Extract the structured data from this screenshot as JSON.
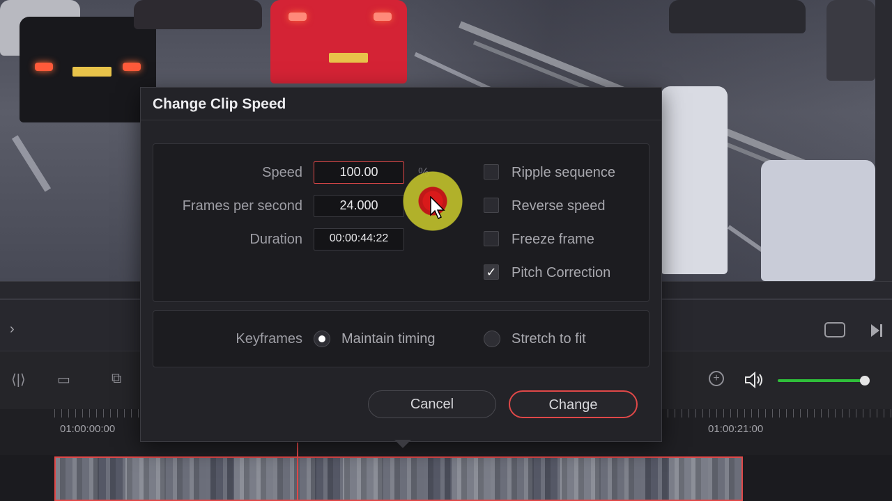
{
  "dialog": {
    "title": "Change Clip Speed",
    "speed_label": "Speed",
    "speed_value": "100.00",
    "speed_unit": "%",
    "fps_label": "Frames per second",
    "fps_value": "24.000",
    "duration_label": "Duration",
    "duration_value": "00:00:44:22",
    "options": [
      {
        "label": "Ripple sequence",
        "checked": false
      },
      {
        "label": "Reverse speed",
        "checked": false
      },
      {
        "label": "Freeze frame",
        "checked": false
      },
      {
        "label": "Pitch Correction",
        "checked": true
      }
    ],
    "keyframes_label": "Keyframes",
    "keyframe_options": [
      {
        "label": "Maintain timing",
        "selected": true
      },
      {
        "label": "Stretch to fit",
        "selected": false
      }
    ],
    "cancel_label": "Cancel",
    "change_label": "Change"
  },
  "timeline": {
    "start_tc": "01:00:00:00",
    "mid_tc": "01:00:21:00"
  },
  "colors": {
    "accent_red": "#e04848",
    "volume_green": "#2fbf3a"
  }
}
